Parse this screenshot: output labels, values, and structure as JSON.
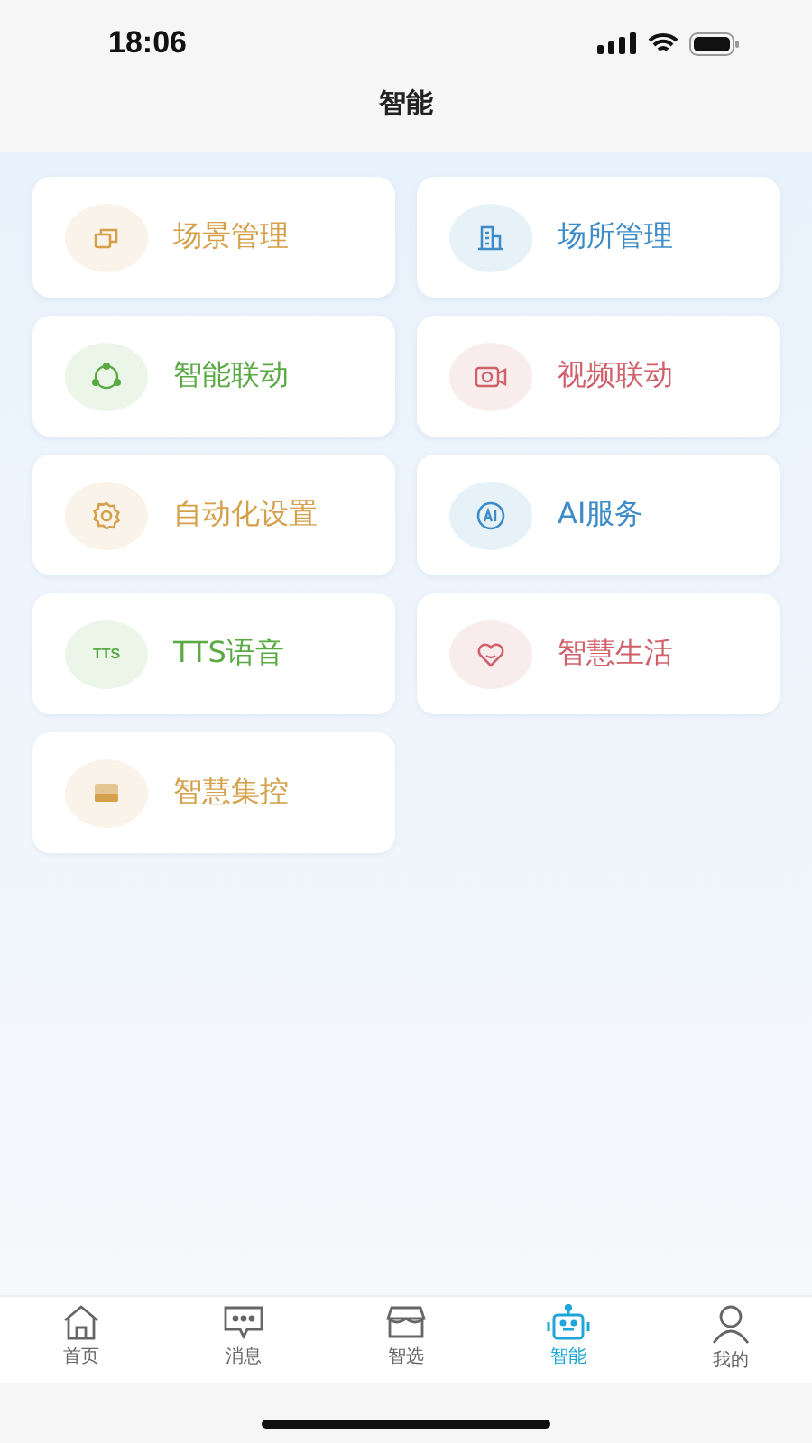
{
  "status_bar": {
    "time": "18:06"
  },
  "header": {
    "title": "智能"
  },
  "tiles": [
    {
      "label": "场景管理",
      "color": "#d4a04a"
    },
    {
      "label": "场所管理",
      "color": "#3d8cc8"
    },
    {
      "label": "智能联动",
      "color": "#5aaa44"
    },
    {
      "label": "视频联动",
      "color": "#d0606a"
    },
    {
      "label": "自动化设置",
      "color": "#d4a04a"
    },
    {
      "label": "AI服务",
      "color": "#3d8cc8"
    },
    {
      "label": "TTS语音",
      "color": "#5aaa44",
      "icon_text": "TTS"
    },
    {
      "label": "智慧生活",
      "color": "#d0606a"
    },
    {
      "label": "智慧集控",
      "color": "#d4a04a"
    }
  ],
  "tab_bar": [
    {
      "label": "首页",
      "selected": false
    },
    {
      "label": "消息",
      "selected": false
    },
    {
      "label": "智选",
      "selected": false
    },
    {
      "label": "智能",
      "selected": true
    },
    {
      "label": "我的",
      "selected": false
    }
  ]
}
